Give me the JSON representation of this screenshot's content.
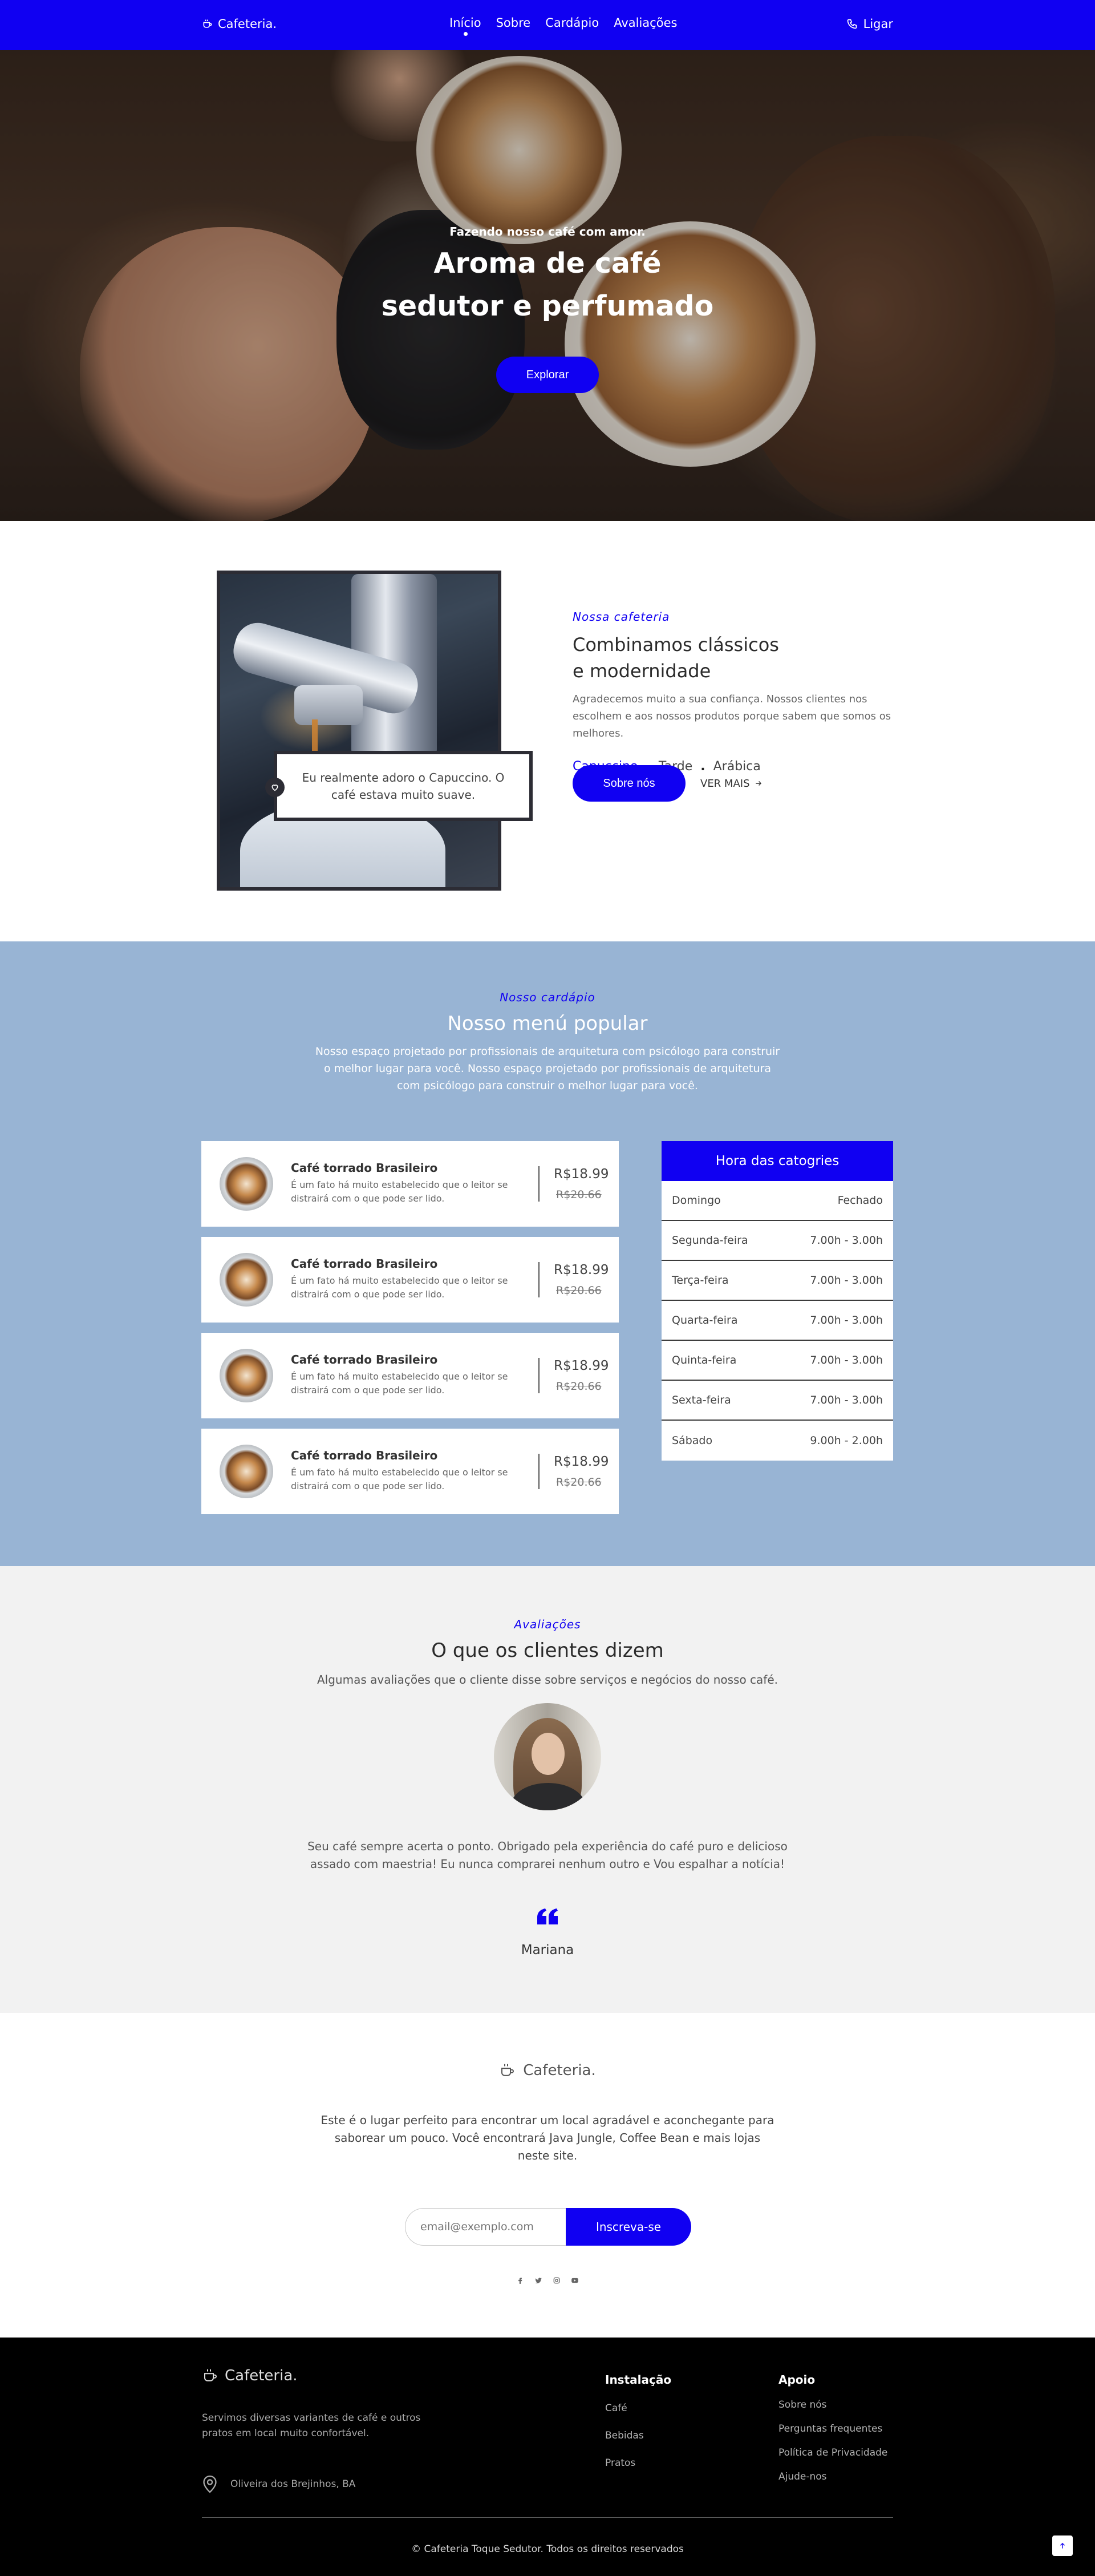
{
  "header": {
    "logo_text": "Cafeteria.",
    "nav": [
      {
        "label": "Início",
        "active": true
      },
      {
        "label": "Sobre",
        "active": false
      },
      {
        "label": "Cardápio",
        "active": false
      },
      {
        "label": "Avaliações",
        "active": false
      }
    ],
    "call_label": "Ligar"
  },
  "hero": {
    "kicker": "Fazendo nosso café com amor.",
    "title_line1": "Aroma de café",
    "title_line2": "sedutor e perfumado",
    "button_label": "Explorar"
  },
  "about": {
    "quote": "Eu realmente adoro o Capuccino. O café estava muito suave.",
    "kicker": "Nossa cafeteria",
    "title_line1": "Combinamos clássicos",
    "title_line2": "e modernidade",
    "description": "Agradecemos muito a sua confiança. Nossos clientes nos escolhem e aos nossos produtos porque sabem que somos os melhores.",
    "tags": [
      "Capuccino",
      "Tarde",
      "Arábica"
    ],
    "tag_separator": ".",
    "primary_button": "Sobre nós",
    "secondary_link": "VER MAIS"
  },
  "menu": {
    "kicker": "Nosso cardápio",
    "title": "Nosso menú popular",
    "description": "Nosso espaço projetado por profissionais de arquitetura com psicólogo para construir o melhor lugar para você. Nosso espaço projetado por profissionais de arquitetura com psicólogo para construir o melhor lugar para você.",
    "items": [
      {
        "name": "Café torrado Brasileiro",
        "description": "É um fato há muito estabelecido que o leitor se distrairá com o que pode ser lido.",
        "price": "R$18.99",
        "old_price": "R$20.66"
      },
      {
        "name": "Café torrado Brasileiro",
        "description": "É um fato há muito estabelecido que o leitor se distrairá com o que pode ser lido.",
        "price": "R$18.99",
        "old_price": "R$20.66"
      },
      {
        "name": "Café torrado Brasileiro",
        "description": "É um fato há muito estabelecido que o leitor se distrairá com o que pode ser lido.",
        "price": "R$18.99",
        "old_price": "R$20.66"
      },
      {
        "name": "Café torrado Brasileiro",
        "description": "É um fato há muito estabelecido que o leitor se distrairá com o que pode ser lido.",
        "price": "R$18.99",
        "old_price": "R$20.66"
      }
    ],
    "hours": {
      "title": "Hora das catogries",
      "rows": [
        {
          "day": "Domingo",
          "time": "Fechado"
        },
        {
          "day": "Segunda-feira",
          "time": "7.00h - 3.00h"
        },
        {
          "day": "Terça-feira",
          "time": "7.00h - 3.00h"
        },
        {
          "day": "Quarta-feira",
          "time": "7.00h - 3.00h"
        },
        {
          "day": "Quinta-feira",
          "time": "7.00h - 3.00h"
        },
        {
          "day": "Sexta-feira",
          "time": "7.00h - 3.00h"
        },
        {
          "day": "Sábado",
          "time": "9.00h - 2.00h"
        }
      ]
    }
  },
  "reviews": {
    "kicker": "Avaliações",
    "title": "O que os clientes dizem",
    "subtitle": "Algumas avaliações que o cliente disse sobre serviços e negócios do nosso café.",
    "text": "Seu café sempre acerta o ponto. Obrigado pela experiência do café puro e delicioso assado com maestria! Eu nunca comprarei nenhum outro e Vou espalhar a notícia!",
    "name": "Mariana"
  },
  "newsletter": {
    "logo_text": "Cafeteria.",
    "text": "Este é o lugar perfeito para encontrar um local agradável e aconchegante para saborear um pouco. Você encontrará Java Jungle, Coffee Bean e mais lojas neste site.",
    "input_placeholder": "email@exemplo.com",
    "button_label": "Inscreva-se",
    "socials": [
      "facebook-icon",
      "twitter-icon",
      "instagram-icon",
      "youtube-icon"
    ]
  },
  "footer": {
    "logo_text": "Cafeteria.",
    "description": "Servimos diversas variantes de café e outros pratos em local muito confortável.",
    "address": "Oliveira dos Brejinhos, BA",
    "col1": {
      "title": "Instalação",
      "links": [
        "Café",
        "Bebidas",
        "Pratos"
      ]
    },
    "col2": {
      "title": "Apoio",
      "links": [
        "Sobre nós",
        "Perguntas frequentes",
        "Política de Privacidade",
        "Ajude-nos"
      ]
    },
    "copyright": "© Cafeteria Toque Sedutor. Todos os direitos reservados"
  },
  "colors": {
    "brand_blue": "#1000f2",
    "menu_bg": "#98b4d4",
    "reviews_bg": "#f2f2f2",
    "footer_bg": "#000000"
  }
}
